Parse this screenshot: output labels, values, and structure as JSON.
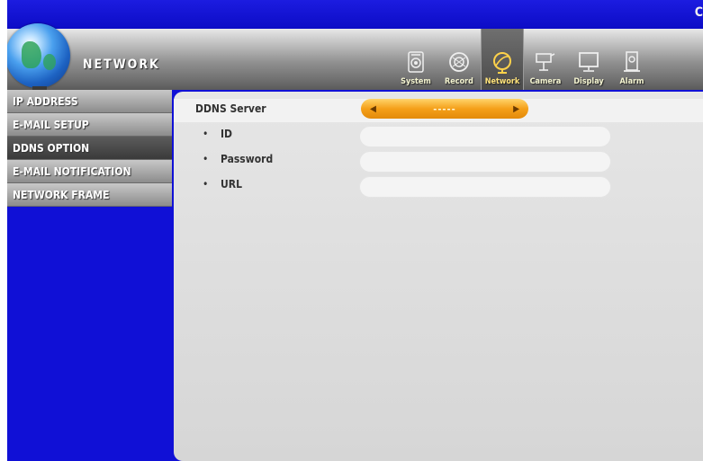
{
  "topbar": {
    "corner_text": "C"
  },
  "header": {
    "title": "NETWORK"
  },
  "tabs": [
    {
      "label": "System",
      "icon": "system-icon",
      "active": false
    },
    {
      "label": "Record",
      "icon": "record-icon",
      "active": false
    },
    {
      "label": "Network",
      "icon": "network-icon",
      "active": true
    },
    {
      "label": "Camera",
      "icon": "camera-icon",
      "active": false
    },
    {
      "label": "Display",
      "icon": "display-icon",
      "active": false
    },
    {
      "label": "Alarm",
      "icon": "alarm-icon",
      "active": false
    }
  ],
  "sidebar": {
    "items": [
      {
        "label": "IP ADDRESS",
        "selected": false
      },
      {
        "label": "E-MAIL SETUP",
        "selected": false
      },
      {
        "label": "DDNS OPTION",
        "selected": true
      },
      {
        "label": "E-MAIL NOTIFICATION",
        "selected": false
      },
      {
        "label": "NETWORK FRAME",
        "selected": false
      }
    ]
  },
  "form": {
    "ddns_server": {
      "label": "DDNS Server",
      "value": "-----"
    },
    "id": {
      "label": "ID",
      "value": ""
    },
    "password": {
      "label": "Password",
      "value": ""
    },
    "url": {
      "label": "URL",
      "value": ""
    },
    "bullet": "•"
  },
  "colors": {
    "topbar": "#1414d8",
    "selector": "#f5a019",
    "active_tab_text": "#ffe37a"
  }
}
